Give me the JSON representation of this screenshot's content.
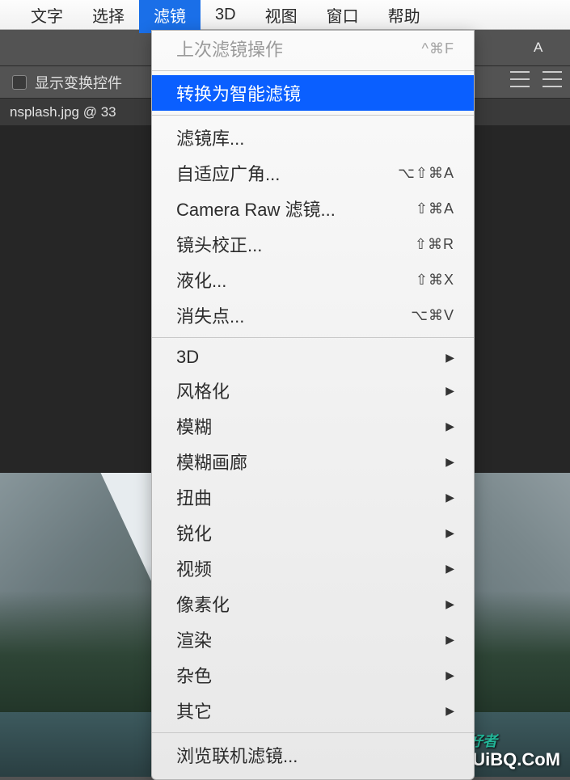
{
  "menubar": {
    "items": [
      {
        "label": "文字"
      },
      {
        "label": "选择"
      },
      {
        "label": "滤镜"
      },
      {
        "label": "3D"
      },
      {
        "label": "视图"
      },
      {
        "label": "窗口"
      },
      {
        "label": "帮助"
      }
    ],
    "active_index": 2
  },
  "toolbar_right_text": "A",
  "options": {
    "show_transform_label": "显示变换控件"
  },
  "tab": {
    "filename": "nsplash.jpg @ 33"
  },
  "dropdown": {
    "last_filter": {
      "label": "上次滤镜操作",
      "shortcut": "^⌘F"
    },
    "convert_smart": {
      "label": "转换为智能滤镜"
    },
    "group2": [
      {
        "label": "滤镜库...",
        "shortcut": ""
      },
      {
        "label": "自适应广角...",
        "shortcut": "⌥⇧⌘A"
      },
      {
        "label": "Camera Raw 滤镜...",
        "shortcut": "⇧⌘A"
      },
      {
        "label": "镜头校正...",
        "shortcut": "⇧⌘R"
      },
      {
        "label": "液化...",
        "shortcut": "⇧⌘X"
      },
      {
        "label": "消失点...",
        "shortcut": "⌥⌘V"
      }
    ],
    "group3": [
      {
        "label": "3D"
      },
      {
        "label": "风格化"
      },
      {
        "label": "模糊"
      },
      {
        "label": "模糊画廊"
      },
      {
        "label": "扭曲"
      },
      {
        "label": "锐化"
      },
      {
        "label": "视频"
      },
      {
        "label": "像素化"
      },
      {
        "label": "渲染"
      },
      {
        "label": "杂色"
      },
      {
        "label": "其它"
      }
    ],
    "browse": {
      "label": "浏览联机滤镜..."
    }
  },
  "watermark": {
    "ps": "PS 爱好者",
    "site": "UiBQ.CoM"
  }
}
